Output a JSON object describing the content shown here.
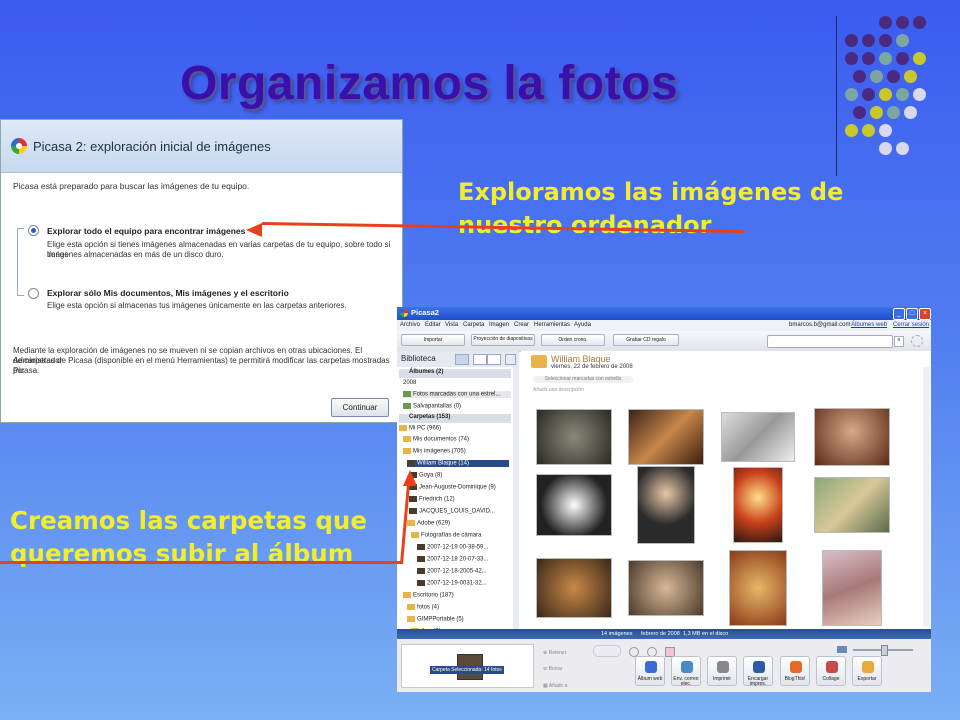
{
  "slide": {
    "title": "Organizamos la fotos",
    "caption_explore": [
      "Exploramos las imágenes de",
      "nuestro ordenador"
    ],
    "caption_folders": [
      "Creamos las carpetas que",
      "queremos subir al álbum"
    ]
  },
  "colors": {
    "title": "#3a10a8",
    "caption": "#f2ee2e",
    "arrow": "#e8401c",
    "dot_purple": "#4a2a80",
    "dot_teal": "#7aa8a0",
    "dot_yellow": "#c8c82a",
    "dot_lavender": "#d8d8f0"
  },
  "dialog": {
    "title": "Picasa 2: exploración inicial de imágenes",
    "intro": "Picasa está preparado para buscar las imágenes de tu equipo.",
    "option1_label": "Explorar todo el equipo para encontrar imágenes",
    "option1_desc": [
      "Elige esta opción si tienes imágenes almacenadas en varias carpetas de tu equipo, sobre todo si tienes",
      "imágenes almacenadas en más de un disco duro."
    ],
    "option2_label": "Explorar sólo Mis documentos, Mis imágenes y el escritorio",
    "option2_desc": "Elige esta opción si almacenas tus imágenes únicamente en las carpetas anteriores.",
    "footer": [
      "Mediante la exploración de imágenes no se mueven ni se copian archivos en otras ubicaciones. El Administrador",
      "de carpetas de Picasa (disponible en el menú Herramientas) te permitirá modificar las carpetas mostradas por",
      "Picasa."
    ],
    "continue_label": "Continuar"
  },
  "picasa": {
    "window_title": "Picasa2",
    "menus": [
      "Archivo",
      "Editar",
      "Vista",
      "Carpeta",
      "Imagen",
      "Crear",
      "Herramientas",
      "Ayuda"
    ],
    "account": "bmarcos.b@gmail.com",
    "albums_link": "Álbumes web",
    "logout_link": "Cerrar sesión",
    "toolbar": {
      "import": "Importar",
      "slideshow": "Proyección de diapositivas",
      "timeline": "Orden crono.",
      "burn": "Grabar CD regalo"
    },
    "library_label": "Biblioteca",
    "sidebar": {
      "albums_header": "Álbumes (2)",
      "year": "2008",
      "album1": "Fotos marcadas con una estrel...",
      "album2": "Salvapantallas (0)",
      "folders_header": "Carpetas (153)",
      "folders": [
        "Mi PC (966)",
        "Mis documentos (74)",
        "Mis imágenes (705)",
        "William Blaque (14)",
        "Goya (8)",
        "Jean-Auguste-Dominique (9)",
        "Friedrich (12)",
        "JACQUES_LOUIS_DAVID...",
        "Adobe (629)",
        "Fotografías de cámara",
        "2007-12-19 00-38-59...",
        "2007-12-18 20-07-33...",
        "2007-12-18-2005-42...",
        "2007-12-19-0031-32...",
        "Escritorio (187)",
        "fotos (4)",
        "GIMPPortable (5)",
        "App (2)"
      ]
    },
    "folder": {
      "name": "William Blaque",
      "date": "viernes, 22 de febrero de 2008",
      "select_starred": "Seleccionar marcadas con estrella",
      "add_description": "Añadir una descripción"
    },
    "status": {
      "count": "14 imágenes",
      "date": "febrero de 2008",
      "size": "1,3 MB en el disco"
    },
    "tray": {
      "selection_label": "Carpeta Seleccionada: 14 fotos",
      "retener": "Retener",
      "borrar": "Borrar",
      "anadir": "Añadir a"
    },
    "actions": [
      "Álbum web",
      "Env. correo elec.",
      "Imprimir",
      "Encargar impres.",
      "BlogThis!",
      "Collage",
      "Exportar"
    ]
  }
}
